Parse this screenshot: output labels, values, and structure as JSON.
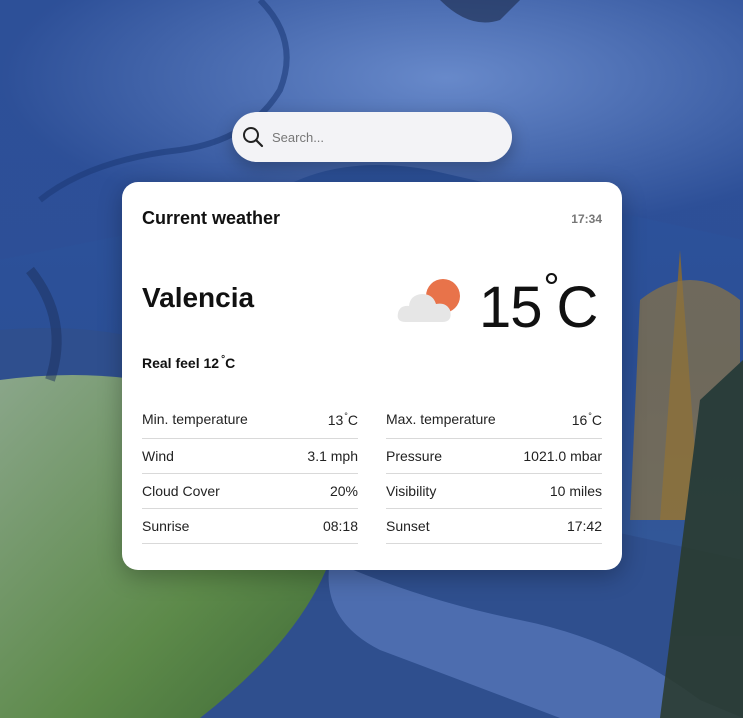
{
  "search": {
    "placeholder": "Search..."
  },
  "card": {
    "title": "Current weather",
    "time": "17:34",
    "city": "Valencia",
    "temperature": "15",
    "temperature_unit": "C",
    "condition_icon": "partly-cloudy-icon",
    "real_feel_label": "Real feel 12",
    "real_feel_unit": "C",
    "details_left": [
      {
        "label": "Min. temperature",
        "value": "13",
        "unit": "C"
      },
      {
        "label": "Wind",
        "value": "3.1 mph"
      },
      {
        "label": "Cloud Cover",
        "value": "20%"
      },
      {
        "label": "Sunrise",
        "value": "08:18"
      }
    ],
    "details_right": [
      {
        "label": "Max. temperature",
        "value": "16",
        "unit": "C"
      },
      {
        "label": "Pressure",
        "value": "1021.0 mbar"
      },
      {
        "label": "Visibility",
        "value": "10 miles"
      },
      {
        "label": "Sunset",
        "value": "17:42"
      }
    ]
  },
  "colors": {
    "card_bg": "#ffffff",
    "sun": "#e8734a",
    "cloud": "#e6e6e6",
    "search_bg": "#f3f3f6"
  }
}
